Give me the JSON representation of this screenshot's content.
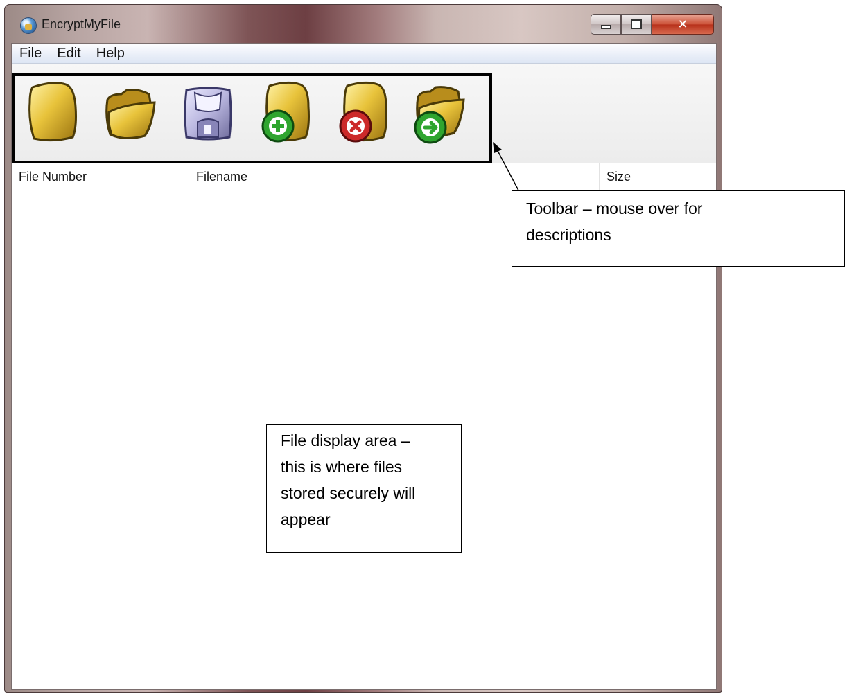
{
  "window": {
    "title": "EncryptMyFile",
    "caption_buttons": {
      "minimize": "minimize",
      "maximize": "maximize",
      "close": "close"
    }
  },
  "menu": [
    "File",
    "Edit",
    "Help"
  ],
  "toolbar": {
    "buttons": [
      {
        "icon": "new-file-icon",
        "color": "#e6c23a"
      },
      {
        "icon": "open-folder-icon",
        "color": "#e6c23a"
      },
      {
        "icon": "save-disk-icon",
        "color": "#b9b6df"
      },
      {
        "icon": "add-file-icon",
        "badge_color": "#2fa52f"
      },
      {
        "icon": "remove-file-icon",
        "badge_color": "#cc2a2a"
      },
      {
        "icon": "export-folder-icon",
        "badge_color": "#2fa52f"
      }
    ]
  },
  "file_list": {
    "columns": [
      "File Number",
      "Filename",
      "Size"
    ],
    "rows": []
  },
  "annotations": {
    "toolbar_note": [
      "Toolbar – mouse over for",
      "descriptions"
    ],
    "area_note": [
      "File display area –",
      "this is where files",
      "stored securely will",
      "appear"
    ]
  }
}
